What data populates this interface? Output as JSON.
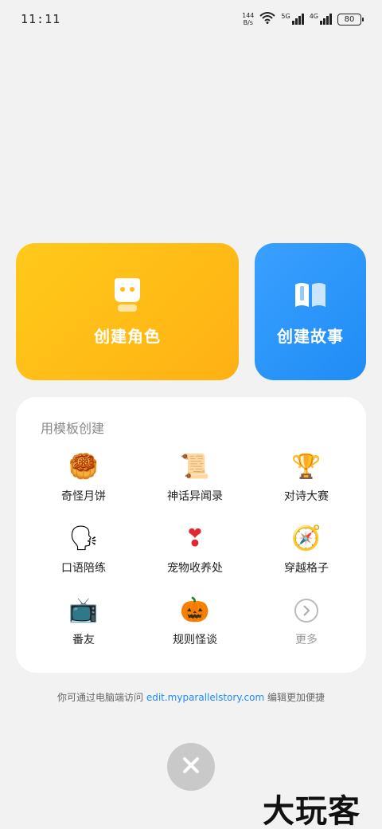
{
  "status_bar": {
    "time": "11:11",
    "net_speed_value": "144",
    "net_speed_unit": "B/s",
    "sig1_label": "5G",
    "sig2_label": "4G",
    "battery": "80"
  },
  "cards": {
    "role_title": "创建角色",
    "story_title": "创建故事"
  },
  "templates": {
    "title": "用模板创建",
    "items": [
      {
        "label": "奇怪月饼",
        "icon": "mooncake-icon",
        "glyph": "🥮"
      },
      {
        "label": "神话异闻录",
        "icon": "scroll-icon",
        "glyph": "📜"
      },
      {
        "label": "对诗大赛",
        "icon": "trophy-icon",
        "glyph": "🏆"
      },
      {
        "label": "口语陪练",
        "icon": "speaking-head-icon",
        "glyph": "🗣"
      },
      {
        "label": "宠物收养处",
        "icon": "heart-exclamation-icon",
        "glyph": "❣"
      },
      {
        "label": "穿越格子",
        "icon": "compass-icon",
        "glyph": "🧭"
      },
      {
        "label": "番友",
        "icon": "tv-icon",
        "glyph": "📺"
      },
      {
        "label": "规则怪谈",
        "icon": "pumpkin-icon",
        "glyph": "🎃"
      }
    ],
    "more_label": "更多"
  },
  "hint": {
    "prefix": "你可通过电脑端访问",
    "link": "edit.myparallelstory.com",
    "suffix": "编辑更加便捷"
  },
  "watermark": "大玩客",
  "colors": {
    "role_card": "#ffb714",
    "story_card": "#2b95fa",
    "link": "#1f8cf5",
    "background": "#f2f2f2"
  }
}
